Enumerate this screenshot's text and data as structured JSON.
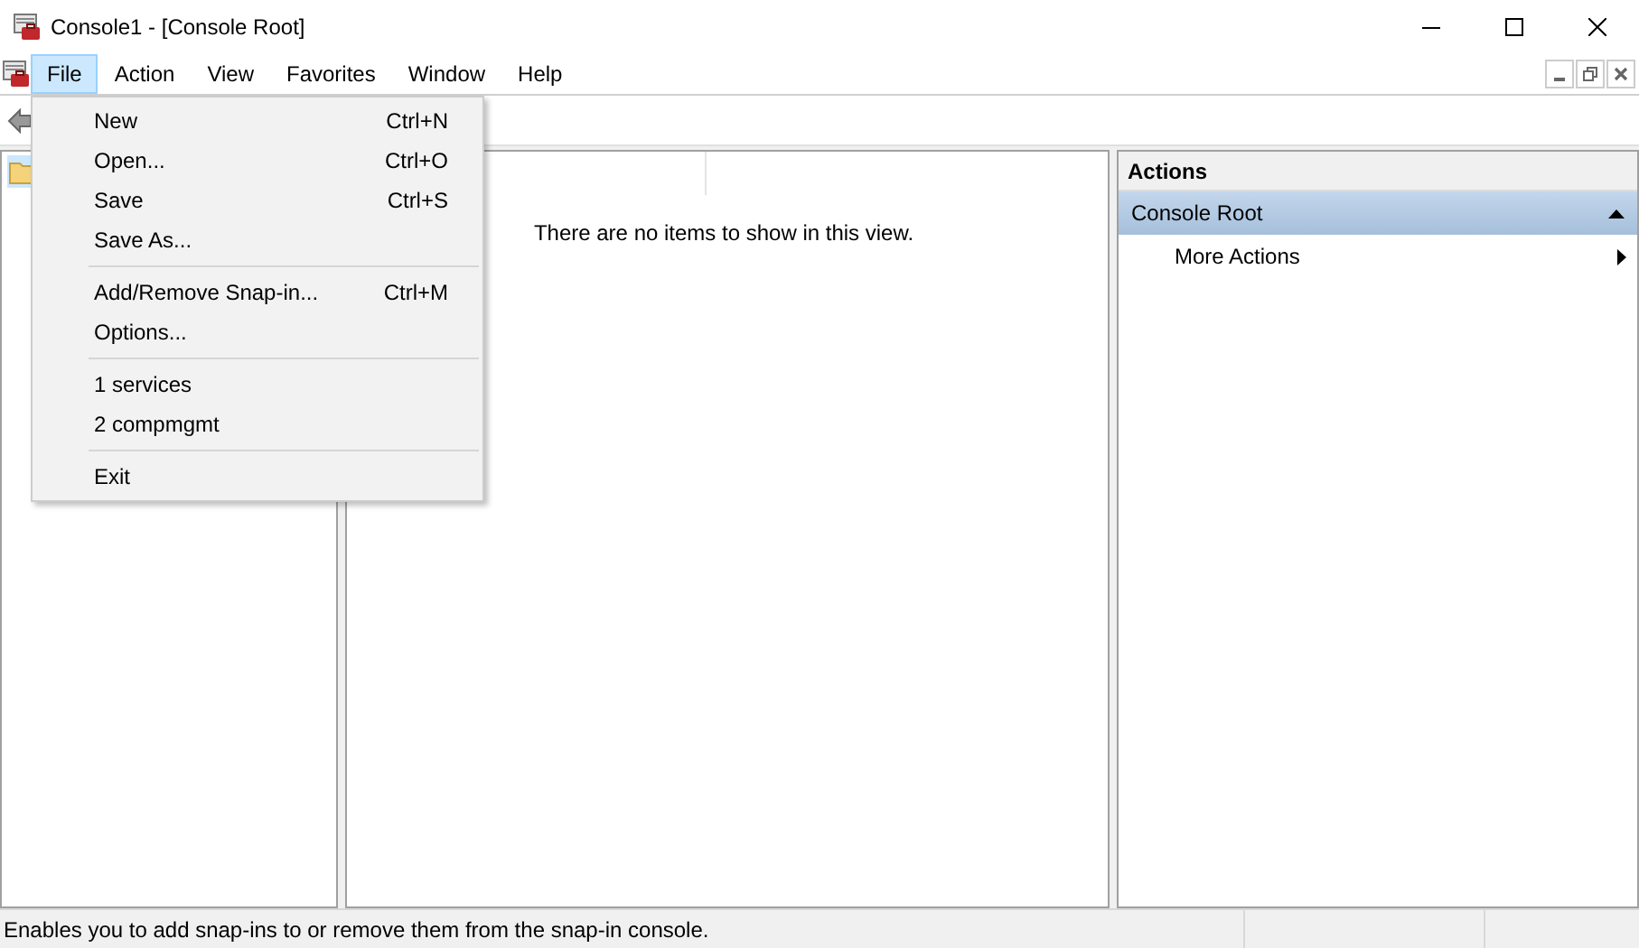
{
  "window": {
    "title": "Console1 - [Console Root]"
  },
  "menu_bar": [
    {
      "label": "File",
      "selected": true
    },
    {
      "label": "Action",
      "selected": false
    },
    {
      "label": "View",
      "selected": false
    },
    {
      "label": "Favorites",
      "selected": false
    },
    {
      "label": "Window",
      "selected": false
    },
    {
      "label": "Help",
      "selected": false
    }
  ],
  "file_menu": [
    {
      "kind": "item",
      "label": "New",
      "shortcut": "Ctrl+N"
    },
    {
      "kind": "item",
      "label": "Open...",
      "shortcut": "Ctrl+O"
    },
    {
      "kind": "item",
      "label": "Save",
      "shortcut": "Ctrl+S"
    },
    {
      "kind": "item",
      "label": "Save As..."
    },
    {
      "kind": "separator"
    },
    {
      "kind": "item",
      "label": "Add/Remove Snap-in...",
      "shortcut": "Ctrl+M"
    },
    {
      "kind": "item",
      "label": "Options..."
    },
    {
      "kind": "separator"
    },
    {
      "kind": "item",
      "label": "1 services"
    },
    {
      "kind": "item",
      "label": "2 compmgmt"
    },
    {
      "kind": "separator"
    },
    {
      "kind": "item",
      "label": "Exit"
    }
  ],
  "center_pane": {
    "empty_message": "There are no items to show in this view."
  },
  "actions_pane": {
    "title": "Actions",
    "section": "Console Root",
    "items": [
      "More Actions"
    ]
  },
  "status_bar": {
    "text": "Enables you to add snap-ins to or remove them from the snap-in console."
  }
}
